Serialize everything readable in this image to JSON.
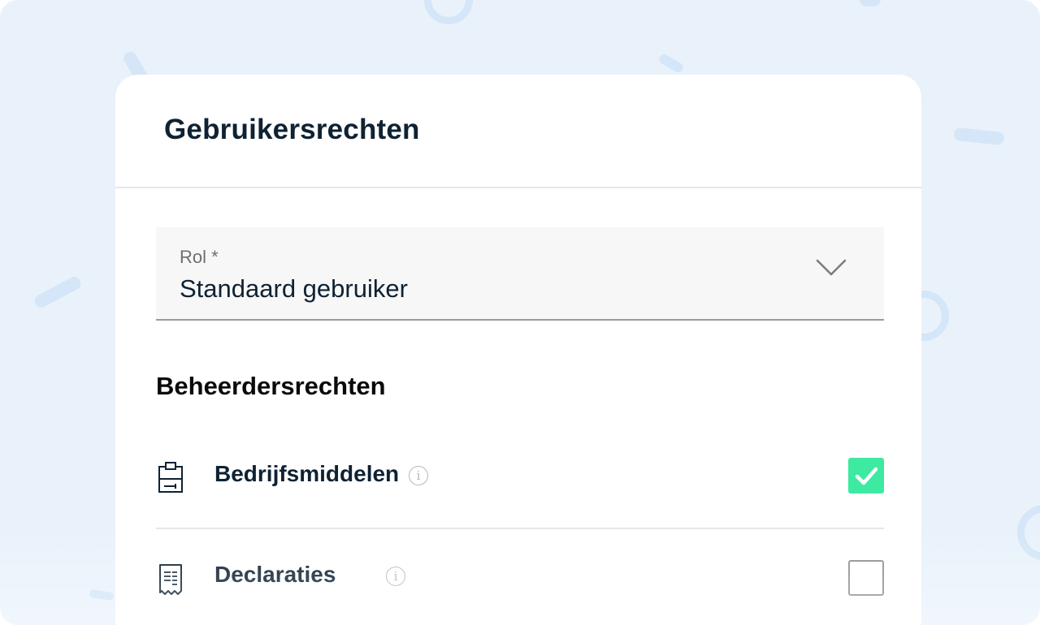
{
  "dialog": {
    "title": "Gebruikersrechten"
  },
  "role": {
    "label": "Rol *",
    "value": "Standaard gebruiker",
    "icon": "chevron-down-icon"
  },
  "section": {
    "title": "Beheerdersrechten"
  },
  "permissions": [
    {
      "label": "Bedrijfsmiddelen",
      "icon": "clipboard-icon",
      "checked": true
    },
    {
      "label": "Declaraties",
      "icon": "receipt-icon",
      "checked": false
    }
  ],
  "colors": {
    "checkbox_checked": "#3ee9a1",
    "title_text": "#0f2233",
    "background": "#e9f2fb"
  }
}
